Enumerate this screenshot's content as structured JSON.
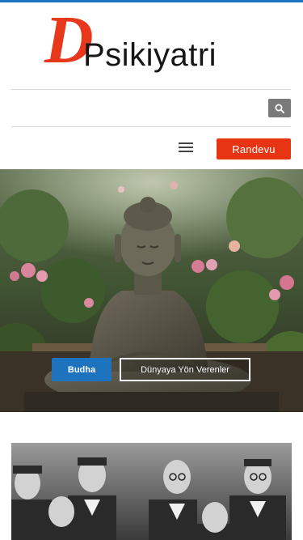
{
  "header": {
    "logo_initial": "D",
    "logo_text": "Psikiyatri"
  },
  "search": {
    "button_icon": "search-icon"
  },
  "nav": {
    "menu_icon": "hamburger-icon",
    "appointment_label": "Randevu"
  },
  "hero": {
    "image_subject": "buddha-statue-photo",
    "tags": [
      {
        "label": "Budha"
      },
      {
        "label": "Dünyaya Yön Verenler"
      }
    ]
  },
  "second_card": {
    "image_subject": "group-photo"
  },
  "colors": {
    "accent_blue": "#1e73be",
    "brand_red": "#e73514",
    "search_grey": "#7a7a7a"
  }
}
